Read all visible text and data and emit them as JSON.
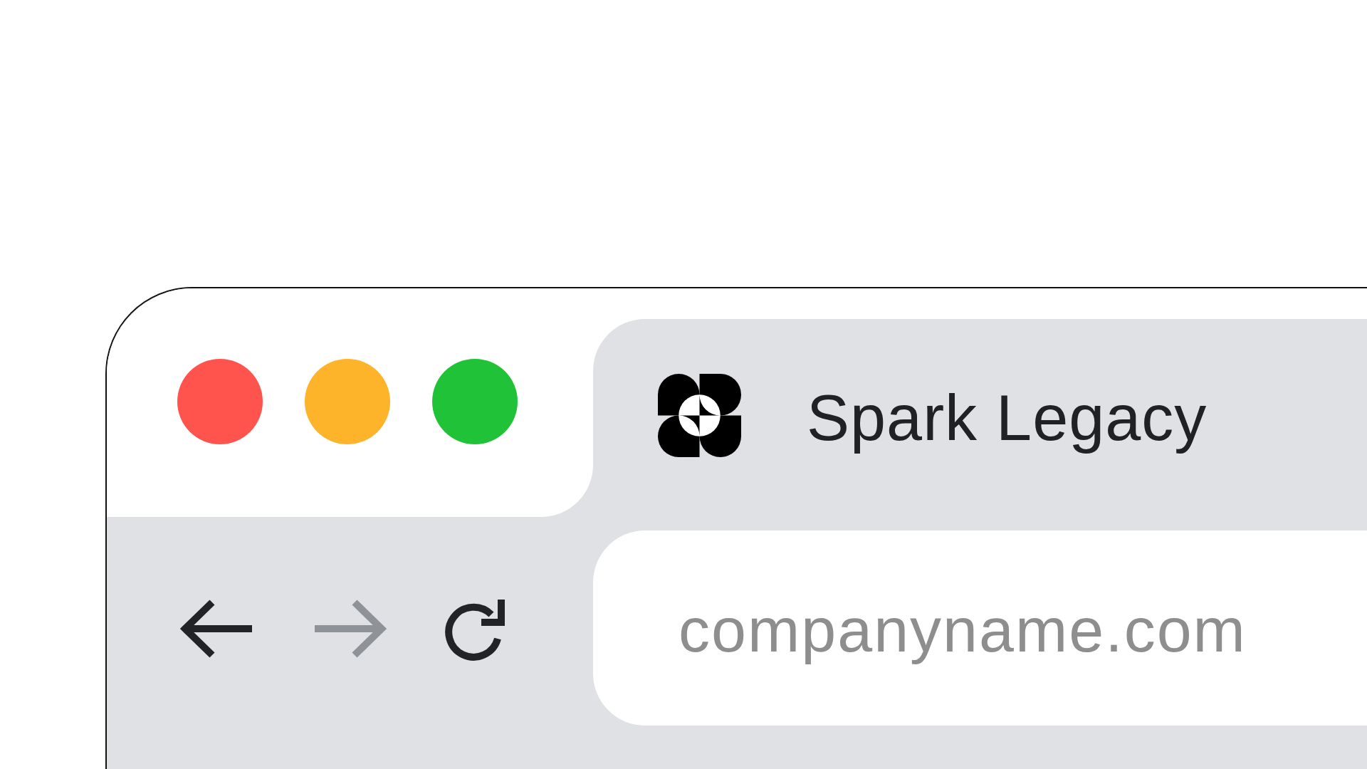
{
  "window_controls": [
    {
      "color": "#ff544d"
    },
    {
      "color": "#fdb32a"
    },
    {
      "color": "#20c238"
    }
  ],
  "tab": {
    "title": "Spark Legacy"
  },
  "toolbar": {
    "buttons": [
      {
        "kind": "back",
        "disabled": false
      },
      {
        "kind": "forward",
        "disabled": true
      },
      {
        "kind": "reload",
        "disabled": false
      }
    ]
  },
  "address_bar": {
    "value": "companyname.com"
  }
}
